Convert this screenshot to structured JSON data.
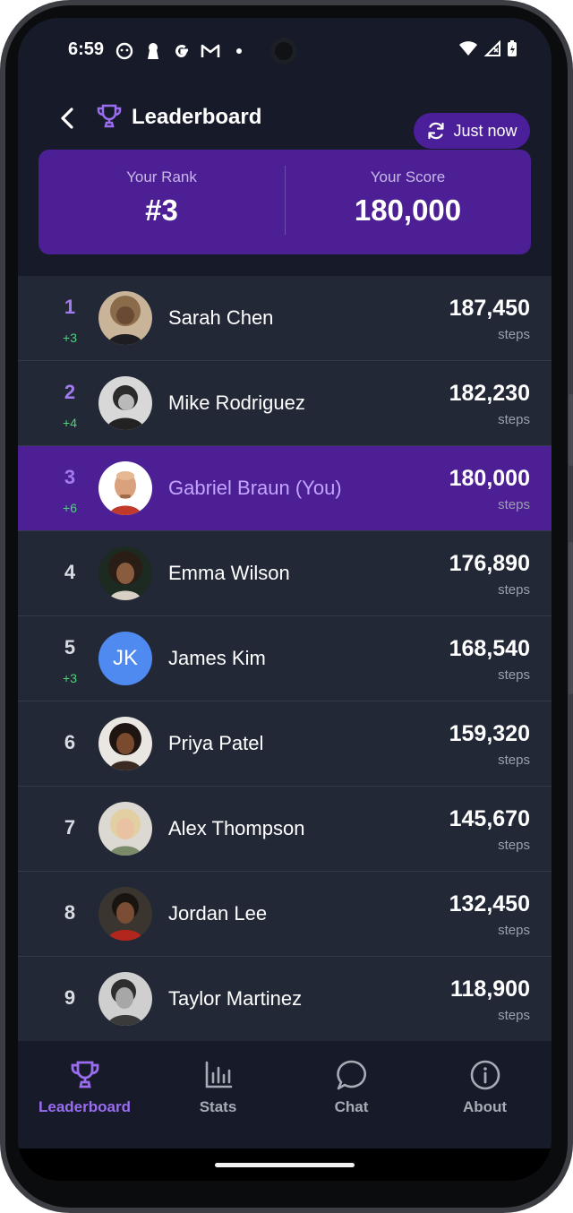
{
  "status_bar": {
    "time": "6:59"
  },
  "header": {
    "title": "Leaderboard",
    "refresh_label": "Just now"
  },
  "rank_card": {
    "rank_label": "Your Rank",
    "rank_value": "#3",
    "score_label": "Your Score",
    "score_value": "180,000"
  },
  "leaderboard": [
    {
      "rank": "1",
      "delta": "+3",
      "name": "Sarah Chen",
      "score": "187,450",
      "unit": "steps",
      "avatar": "photo-woman-curly",
      "me": false
    },
    {
      "rank": "2",
      "delta": "+4",
      "name": "Mike Rodriguez",
      "score": "182,230",
      "unit": "steps",
      "avatar": "photo-man-bw",
      "me": false
    },
    {
      "rank": "3",
      "delta": "+6",
      "name": "Gabriel Braun (You)",
      "score": "180,000",
      "unit": "steps",
      "avatar": "cartoon-man-bald",
      "me": true
    },
    {
      "rank": "4",
      "delta": "",
      "name": "Emma Wilson",
      "score": "176,890",
      "unit": "steps",
      "avatar": "photo-woman-curly-dark",
      "me": false
    },
    {
      "rank": "5",
      "delta": "+3",
      "name": "James Kim",
      "score": "168,540",
      "unit": "steps",
      "avatar": "initials",
      "initials": "JK",
      "me": false
    },
    {
      "rank": "6",
      "delta": "",
      "name": "Priya Patel",
      "score": "159,320",
      "unit": "steps",
      "avatar": "photo-woman-smile",
      "me": false
    },
    {
      "rank": "7",
      "delta": "",
      "name": "Alex Thompson",
      "score": "145,670",
      "unit": "steps",
      "avatar": "photo-woman-blonde",
      "me": false
    },
    {
      "rank": "8",
      "delta": "",
      "name": "Jordan Lee",
      "score": "132,450",
      "unit": "steps",
      "avatar": "photo-man-red",
      "me": false
    },
    {
      "rank": "9",
      "delta": "",
      "name": "Taylor Martinez",
      "score": "118,900",
      "unit": "steps",
      "avatar": "photo-man-bw-2",
      "me": false
    }
  ],
  "bottom_nav": [
    {
      "label": "Leaderboard",
      "icon": "trophy-icon",
      "active": true
    },
    {
      "label": "Stats",
      "icon": "bar-chart-icon",
      "active": false
    },
    {
      "label": "Chat",
      "icon": "chat-bubble-icon",
      "active": false
    },
    {
      "label": "About",
      "icon": "info-icon",
      "active": false
    }
  ],
  "colors": {
    "background": "#171b29",
    "accent": "#4c1f94",
    "accent_text": "#9a6df0",
    "delta_green": "#4fd37a"
  }
}
